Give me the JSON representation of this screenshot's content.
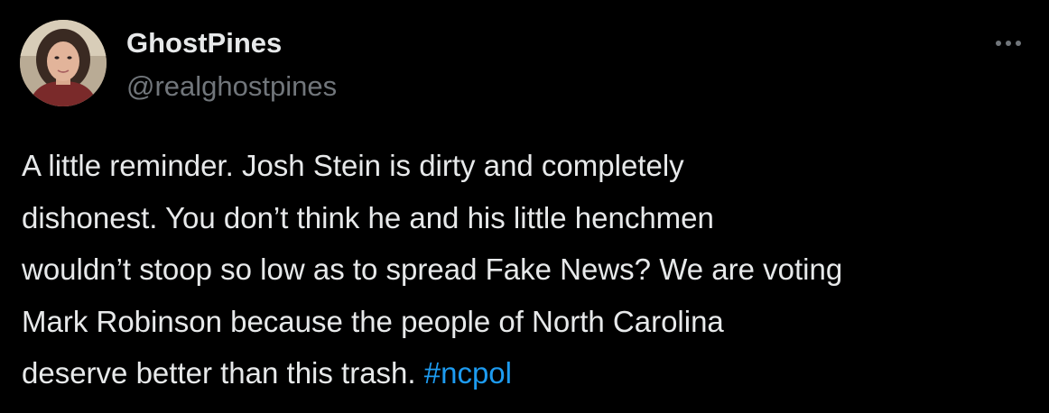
{
  "tweet": {
    "author": {
      "display_name": "GhostPines",
      "handle": "@realghostpines",
      "avatar_icon": "user-avatar"
    },
    "more_icon": "more-horizontal-icon",
    "text_lines": [
      "A little reminder. Josh Stein is dirty and completely",
      "dishonest. You don’t think he and his little henchmen",
      "wouldn’t stoop so low as to spread Fake News? We are voting",
      "Mark Robinson because the people of North Carolina",
      "deserve better than this trash. "
    ],
    "hashtag": "#ncpol"
  },
  "colors": {
    "background": "#000000",
    "primary_text": "#e7e9ea",
    "secondary_text": "#71767b",
    "link": "#1d9bf0"
  }
}
